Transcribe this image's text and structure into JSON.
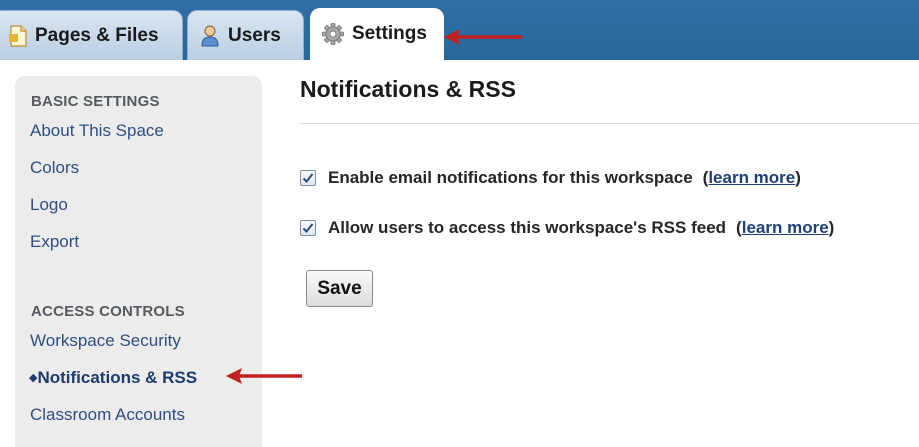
{
  "tabs": [
    {
      "label": "Pages & Files",
      "icon": "page-icon",
      "active": false
    },
    {
      "label": "Users",
      "icon": "user-icon",
      "active": false
    },
    {
      "label": "Settings",
      "icon": "gear-icon",
      "active": true
    }
  ],
  "sidebar": {
    "sections": [
      {
        "heading": "BASIC SETTINGS",
        "items": [
          {
            "label": "About This Space"
          },
          {
            "label": "Colors"
          },
          {
            "label": "Logo"
          },
          {
            "label": "Export"
          }
        ]
      },
      {
        "heading": "ACCESS CONTROLS",
        "items": [
          {
            "label": "Workspace Security"
          },
          {
            "label": "Notifications & RSS",
            "current": true
          },
          {
            "label": "Classroom Accounts"
          }
        ]
      }
    ]
  },
  "main": {
    "title": "Notifications & RSS",
    "options": [
      {
        "label": "Enable email notifications for this workspace",
        "checked": true,
        "link": "learn more"
      },
      {
        "label": "Allow users to access this workspace's RSS feed",
        "checked": true,
        "link": "learn more"
      }
    ],
    "save_label": "Save"
  },
  "colors": {
    "tabbar": "#2f70a6",
    "sidebar_bg": "#ececec",
    "link": "#2f4f82",
    "annotation_arrow": "#c0201f"
  }
}
